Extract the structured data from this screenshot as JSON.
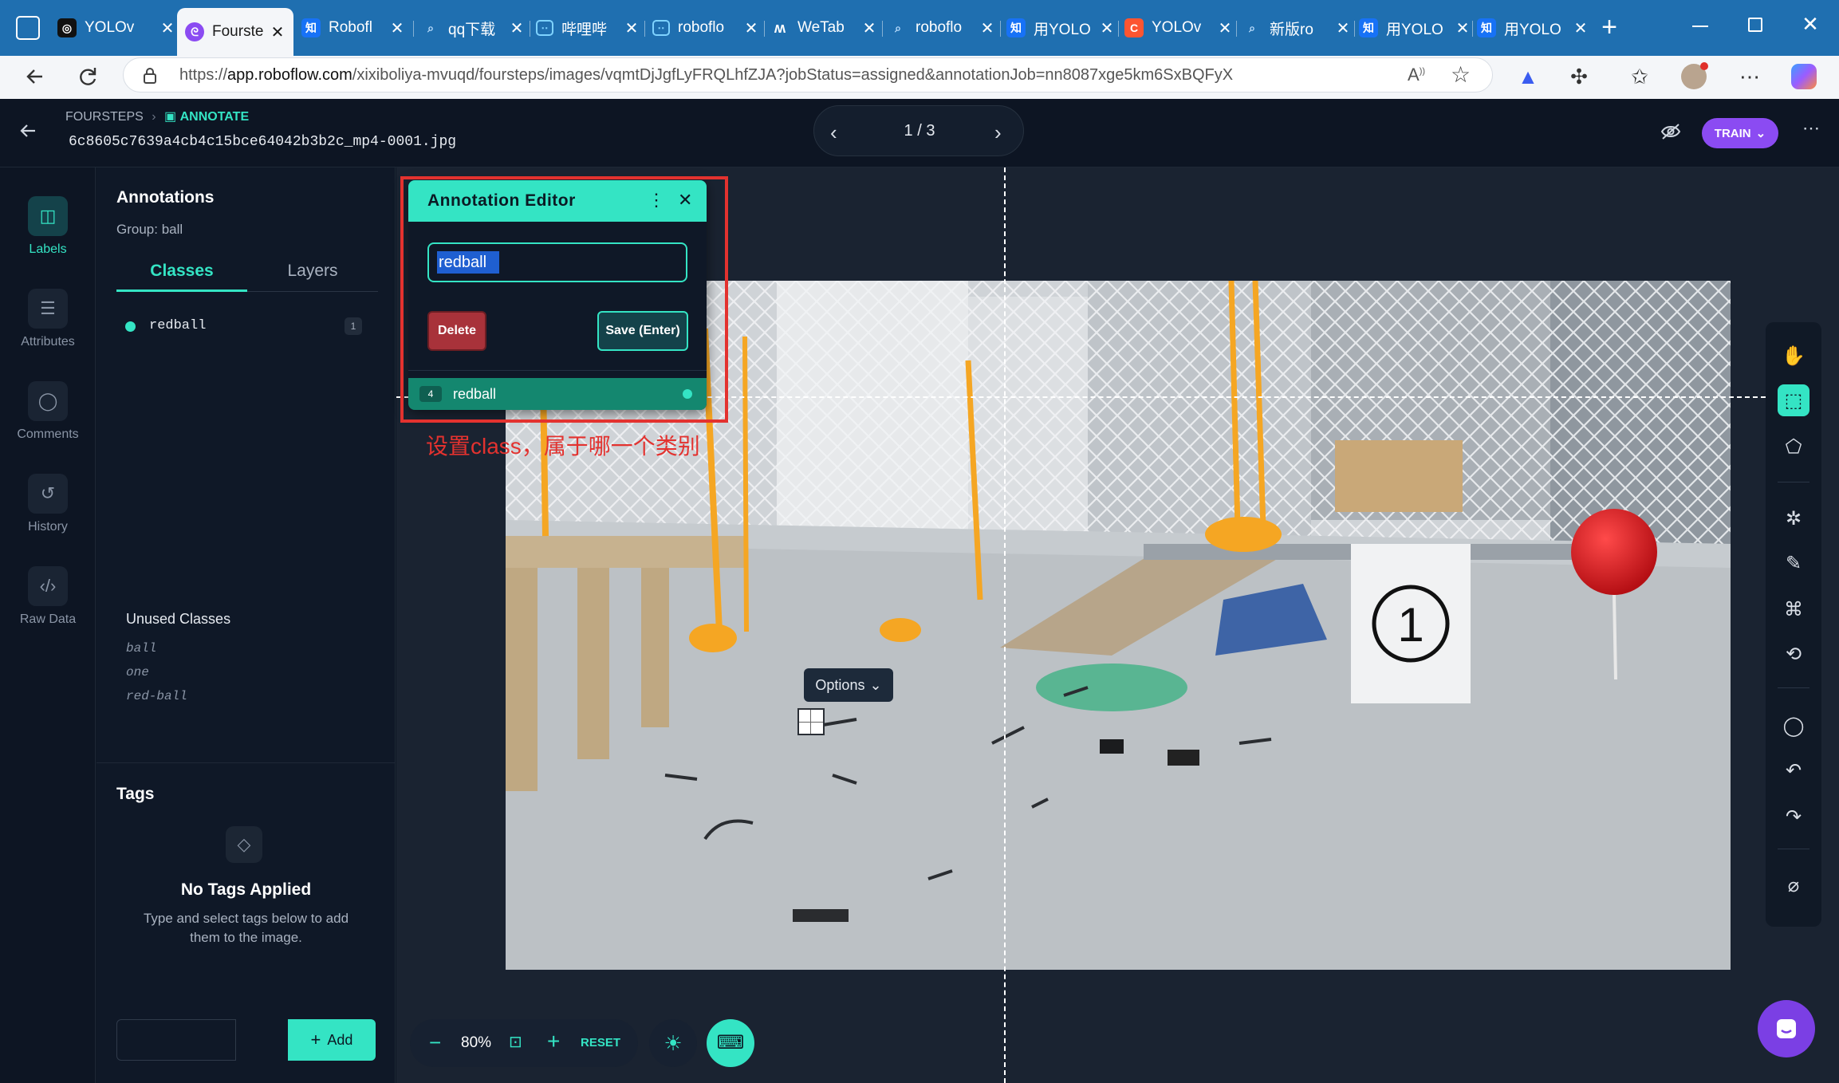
{
  "browser": {
    "tabs": [
      {
        "title": "YOLOv",
        "icon": "openai-icon"
      },
      {
        "title": "Fourste",
        "icon": "roboflow-icon",
        "active": true
      },
      {
        "title": "Robofl",
        "icon": "zhihu-icon"
      },
      {
        "title": "qq下载",
        "icon": "search-icon"
      },
      {
        "title": "哔哩哔",
        "icon": "bilibili-icon"
      },
      {
        "title": "roboflo",
        "icon": "bilibili-icon"
      },
      {
        "title": "WeTab",
        "icon": "wetab-icon"
      },
      {
        "title": "roboflo",
        "icon": "search-icon"
      },
      {
        "title": "用YOLO",
        "icon": "zhihu-icon"
      },
      {
        "title": "YOLOv",
        "icon": "csdn-icon"
      },
      {
        "title": "新版ro",
        "icon": "search-icon"
      },
      {
        "title": "用YOLO",
        "icon": "zhihu-icon"
      },
      {
        "title": "用YOLO",
        "icon": "zhihu-icon"
      }
    ],
    "url_prefix": "https://",
    "url_host": "app.roboflow.com",
    "url_path": "/xixiboliya-mvuqd/foursteps/images/vqmtDjJgfLyFRQLhfZJA?jobStatus=assigned&annotationJob=nn8087xge5km6SxBQFyX"
  },
  "header": {
    "project": "FOURSTEPS",
    "section": "ANNOTATE",
    "filename": "6c8605c7639a4cb4c15bce64042b3b2c_mp4-0001.jpg",
    "pager": "1 / 3",
    "train_label": "TRAIN"
  },
  "rail": [
    {
      "label": "Labels",
      "icon": "label-icon",
      "active": true
    },
    {
      "label": "Attributes",
      "icon": "list-icon"
    },
    {
      "label": "Comments",
      "icon": "comment-icon"
    },
    {
      "label": "History",
      "icon": "history-icon"
    },
    {
      "label": "Raw Data",
      "icon": "code-icon"
    }
  ],
  "panel": {
    "title": "Annotations",
    "group": "Group: ball",
    "tabs": [
      "Classes",
      "Layers"
    ],
    "classes": [
      {
        "name": "redball",
        "count": "1",
        "color": "#34e4c4"
      }
    ],
    "unused_title": "Unused Classes",
    "unused": [
      "ball",
      "one",
      "red-ball"
    ],
    "tags_title": "Tags",
    "no_tags_title": "No Tags Applied",
    "no_tags_text": "Type and select tags below to add them to the image.",
    "add_label": "Add"
  },
  "editor": {
    "title": "Annotation Editor",
    "input_value": "redball",
    "delete_label": "Delete",
    "save_label": "Save (Enter)",
    "row_index": "4",
    "row_label": "redball"
  },
  "annotation_note": "设置class，属于哪一个类别",
  "options_label": "Options",
  "zoom": {
    "value": "80%",
    "reset_label": "RESET"
  },
  "colors": {
    "accent": "#34e4c4",
    "purple": "#8b4bf2",
    "red": "#e3322f",
    "delete": "#a8323a"
  }
}
